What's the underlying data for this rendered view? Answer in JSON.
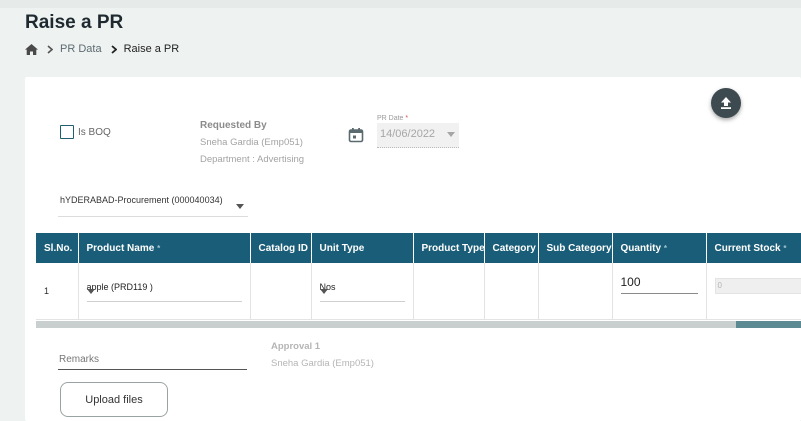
{
  "page": {
    "title": "Raise a PR"
  },
  "breadcrumb": {
    "items": [
      "PR Data",
      "Raise a PR"
    ]
  },
  "form": {
    "is_boq_label": "Is BOQ",
    "requested_by": {
      "title": "Requested By",
      "name": "Sneha Gardia (Emp051)",
      "department": "Department : Advertising"
    },
    "pr_date": {
      "label": "PR Date",
      "required_mark": "*",
      "value": "14/06/2022"
    },
    "department_select": {
      "value": "hYDERABAD-Procurement (000040034)"
    }
  },
  "table": {
    "headers": [
      {
        "label": "Sl.No.",
        "required": ""
      },
      {
        "label": "Product Name",
        "required": "*"
      },
      {
        "label": "Catalog ID",
        "required": ""
      },
      {
        "label": "Unit Type",
        "required": ""
      },
      {
        "label": "Product Type",
        "required": ""
      },
      {
        "label": "Category",
        "required": ""
      },
      {
        "label": "Sub Category",
        "required": ""
      },
      {
        "label": "Quantity",
        "required": "*"
      },
      {
        "label": "Current Stock",
        "required": "*"
      }
    ],
    "rows": [
      {
        "sl_no": "1",
        "product_name": "apple (PRD119 )",
        "catalog_id": "",
        "unit_type": "Nos",
        "product_type": "",
        "category": "",
        "sub_category": "",
        "quantity": "100",
        "current_stock": "0"
      }
    ]
  },
  "remarks": {
    "placeholder": "Remarks"
  },
  "approval": {
    "title": "Approval 1",
    "name": "Sneha Gardia (Emp051)"
  },
  "upload": {
    "label": "Upload files"
  },
  "colors": {
    "header_bg": "#1a5d78",
    "fab_bg": "#3d4a4f",
    "checkbox_border": "#1f5e70",
    "required_star": "#d9534f"
  },
  "icons": {
    "home": "home-icon",
    "fab": "upload-icon",
    "calendar": "calendar-icon"
  }
}
